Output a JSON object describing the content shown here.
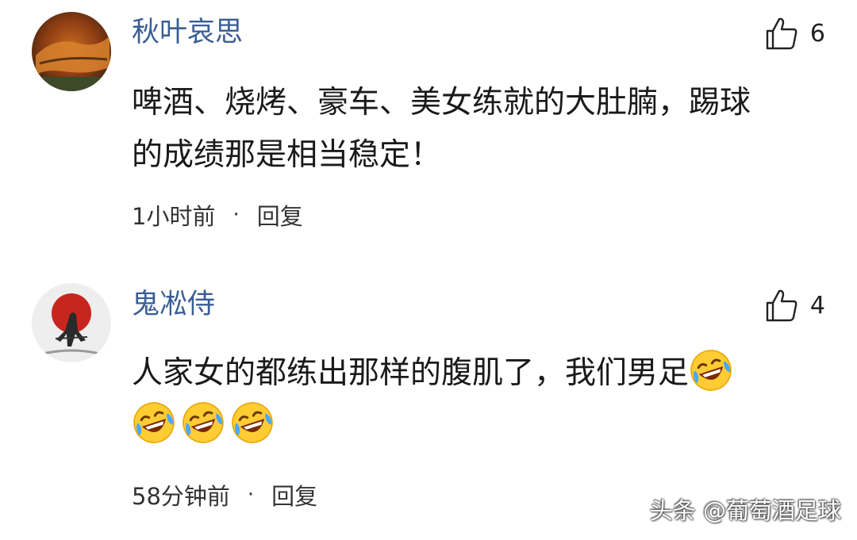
{
  "comments": [
    {
      "username": "秋叶哀思",
      "likes": "6",
      "content_line1": "啤酒、烧烤、豪车、美女练就的大肚腩，踢球",
      "content_line2": "的成绩那是相当稳定！",
      "time": "1小时前",
      "separator": "·",
      "reply_label": "回复"
    },
    {
      "username": "鬼凇侍",
      "likes": "4",
      "content_line1": "人家女的都练出那样的腹肌了，我们男足",
      "time": "58分钟前",
      "separator": "·",
      "reply_label": "回复",
      "emoji_name": "laugh-cry-emoji",
      "emoji_count": 4
    }
  ],
  "watermark": "头条 @葡萄酒足球",
  "colors": {
    "username": "#3a5d95",
    "text": "#1a1a1a",
    "meta": "#333333"
  }
}
